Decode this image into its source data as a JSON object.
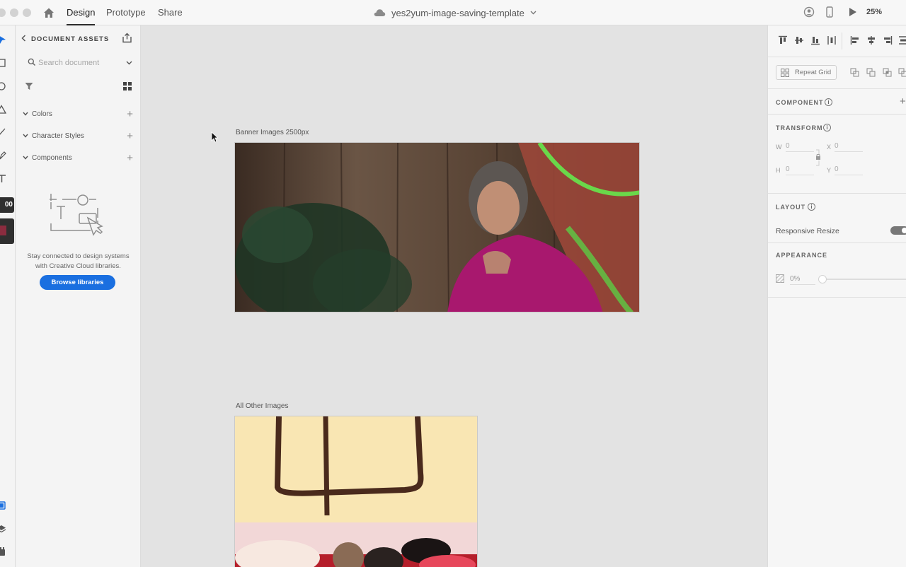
{
  "nav": {
    "tabs": [
      {
        "label": "Design",
        "active": true
      },
      {
        "label": "Prototype",
        "active": false
      },
      {
        "label": "Share",
        "active": false
      }
    ]
  },
  "document": {
    "title": "yes2yum-image-saving-template",
    "zoom": "25%"
  },
  "toolbar": {
    "badge_text": "00",
    "swatch_color": "#8b2c3f"
  },
  "assets": {
    "title": "DOCUMENT ASSETS",
    "search_placeholder": "Search document",
    "sections": [
      {
        "label": "Colors"
      },
      {
        "label": "Character Styles"
      },
      {
        "label": "Components"
      }
    ],
    "empty_message_line1": "Stay connected to design systems",
    "empty_message_line2": "with Creative Cloud libraries.",
    "browse_button": "Browse libraries"
  },
  "canvas": {
    "artboards": [
      {
        "label": "Banner Images 2500px"
      },
      {
        "label": "All Other Images"
      }
    ]
  },
  "inspector": {
    "repeat_grid": "Repeat Grid",
    "component_title": "COMPONENT",
    "transform_title": "TRANSFORM",
    "transform": {
      "w_label": "W",
      "w_value": "0",
      "h_label": "H",
      "h_value": "0",
      "x_label": "X",
      "x_value": "0",
      "y_label": "Y",
      "y_value": "0"
    },
    "layout_title": "LAYOUT",
    "responsive_resize": "Responsive Resize",
    "appearance_title": "APPEARANCE",
    "opacity": "0%",
    "info_glyph": "i"
  },
  "icons": {
    "plus": "+",
    "accent": "#1a6fe0"
  }
}
